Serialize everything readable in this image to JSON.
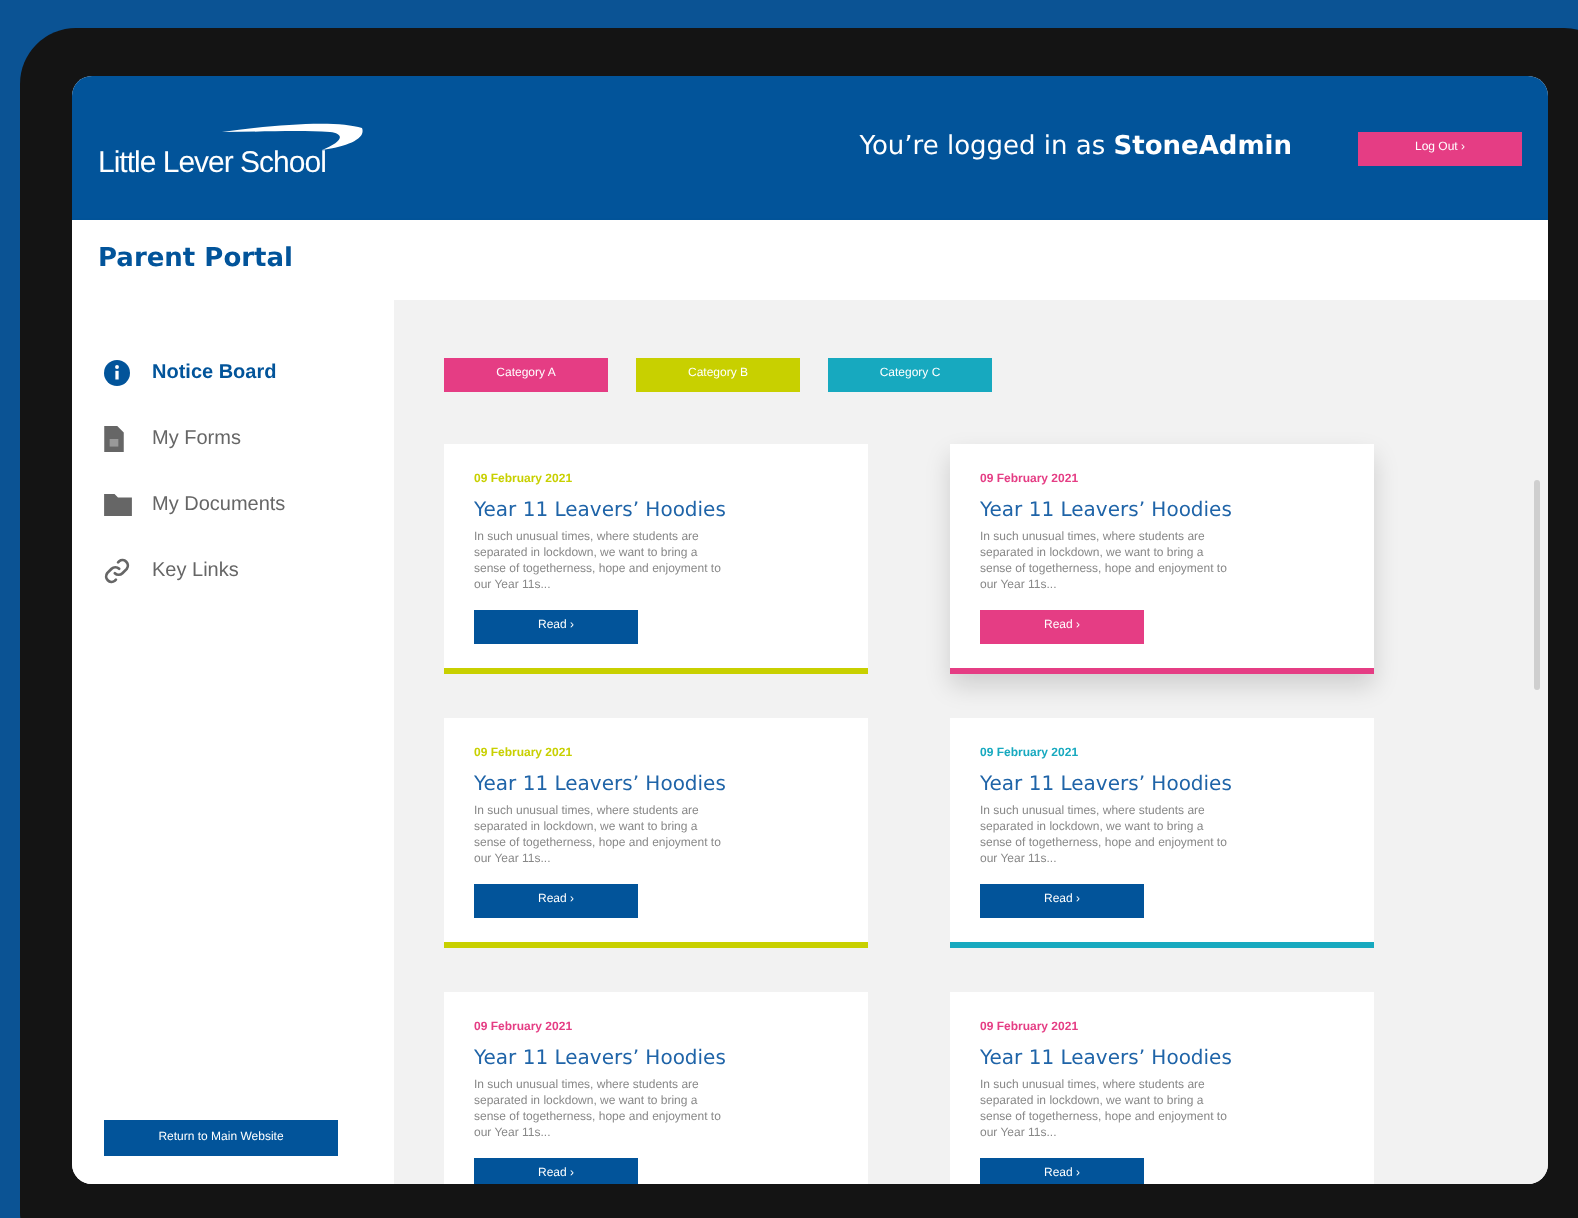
{
  "header": {
    "logo": "Little Lever School",
    "login_prefix": "You’re logged in as",
    "username": "StoneAdmin",
    "logout": "Log Out",
    "logout_chevron": "›"
  },
  "portal_title": "Parent Portal",
  "sidebar": {
    "items": [
      {
        "label": "Notice Board",
        "kind": "info",
        "selected": true
      },
      {
        "label": "My Forms",
        "kind": "form",
        "selected": false
      },
      {
        "label": "My Documents",
        "kind": "folder",
        "selected": false
      },
      {
        "label": "Key Links",
        "kind": "link",
        "selected": false
      }
    ],
    "return_button": "Return to Main Website"
  },
  "categories": [
    {
      "label": "Category A",
      "color": "#e53d84"
    },
    {
      "label": "Category B",
      "color": "#c8d000"
    },
    {
      "label": "Category C",
      "color": "#17a9bf"
    }
  ],
  "cards": [
    {
      "date": "09 February 2021",
      "title": "Year 11 Leavers’ Hoodies",
      "body": "In such unusual times, where students are separated in lockdown, we want to bring a sense of togetherness, hope and enjoyment to our Year 11s...",
      "button": "Read",
      "chevron": "›",
      "color": "#c8d000",
      "highlighted": false
    },
    {
      "date": "09 February 2021",
      "title": "Year 11 Leavers’ Hoodies",
      "body": "In such unusual times, where students are separated in lockdown, we want to bring a sense of togetherness, hope and enjoyment to our Year 11s...",
      "button": "Read",
      "chevron": "›",
      "color": "#e53d84",
      "highlighted": true
    },
    {
      "date": "09 February 2021",
      "title": "Year 11 Leavers’ Hoodies",
      "body": "In such unusual times, where students are separated in lockdown, we want to bring a sense of togetherness, hope and enjoyment to our Year 11s...",
      "button": "Read",
      "chevron": "›",
      "color": "#c8d000",
      "highlighted": false
    },
    {
      "date": "09 February 2021",
      "title": "Year 11 Leavers’ Hoodies",
      "body": "In such unusual times, where students are separated in lockdown, we want to bring a sense of togetherness, hope and enjoyment to our Year 11s...",
      "button": "Read",
      "chevron": "›",
      "color": "#17a9bf",
      "highlighted": false
    },
    {
      "date": "09 February 2021",
      "title": "Year 11 Leavers’ Hoodies",
      "body": "In such unusual times, where students are separated in lockdown, we want to bring a sense of togetherness, hope and enjoyment to our Year 11s...",
      "button": "Read",
      "chevron": "›",
      "color": "#e53d84",
      "highlighted": false
    },
    {
      "date": "09 February 2021",
      "title": "Year 11 Leavers’ Hoodies",
      "body": "In such unusual times, where students are separated in lockdown, we want to bring a sense of togetherness, hope and enjoyment to our Year 11s...",
      "button": "Read",
      "chevron": "›",
      "color": "#e53d84",
      "highlighted": false
    }
  ]
}
